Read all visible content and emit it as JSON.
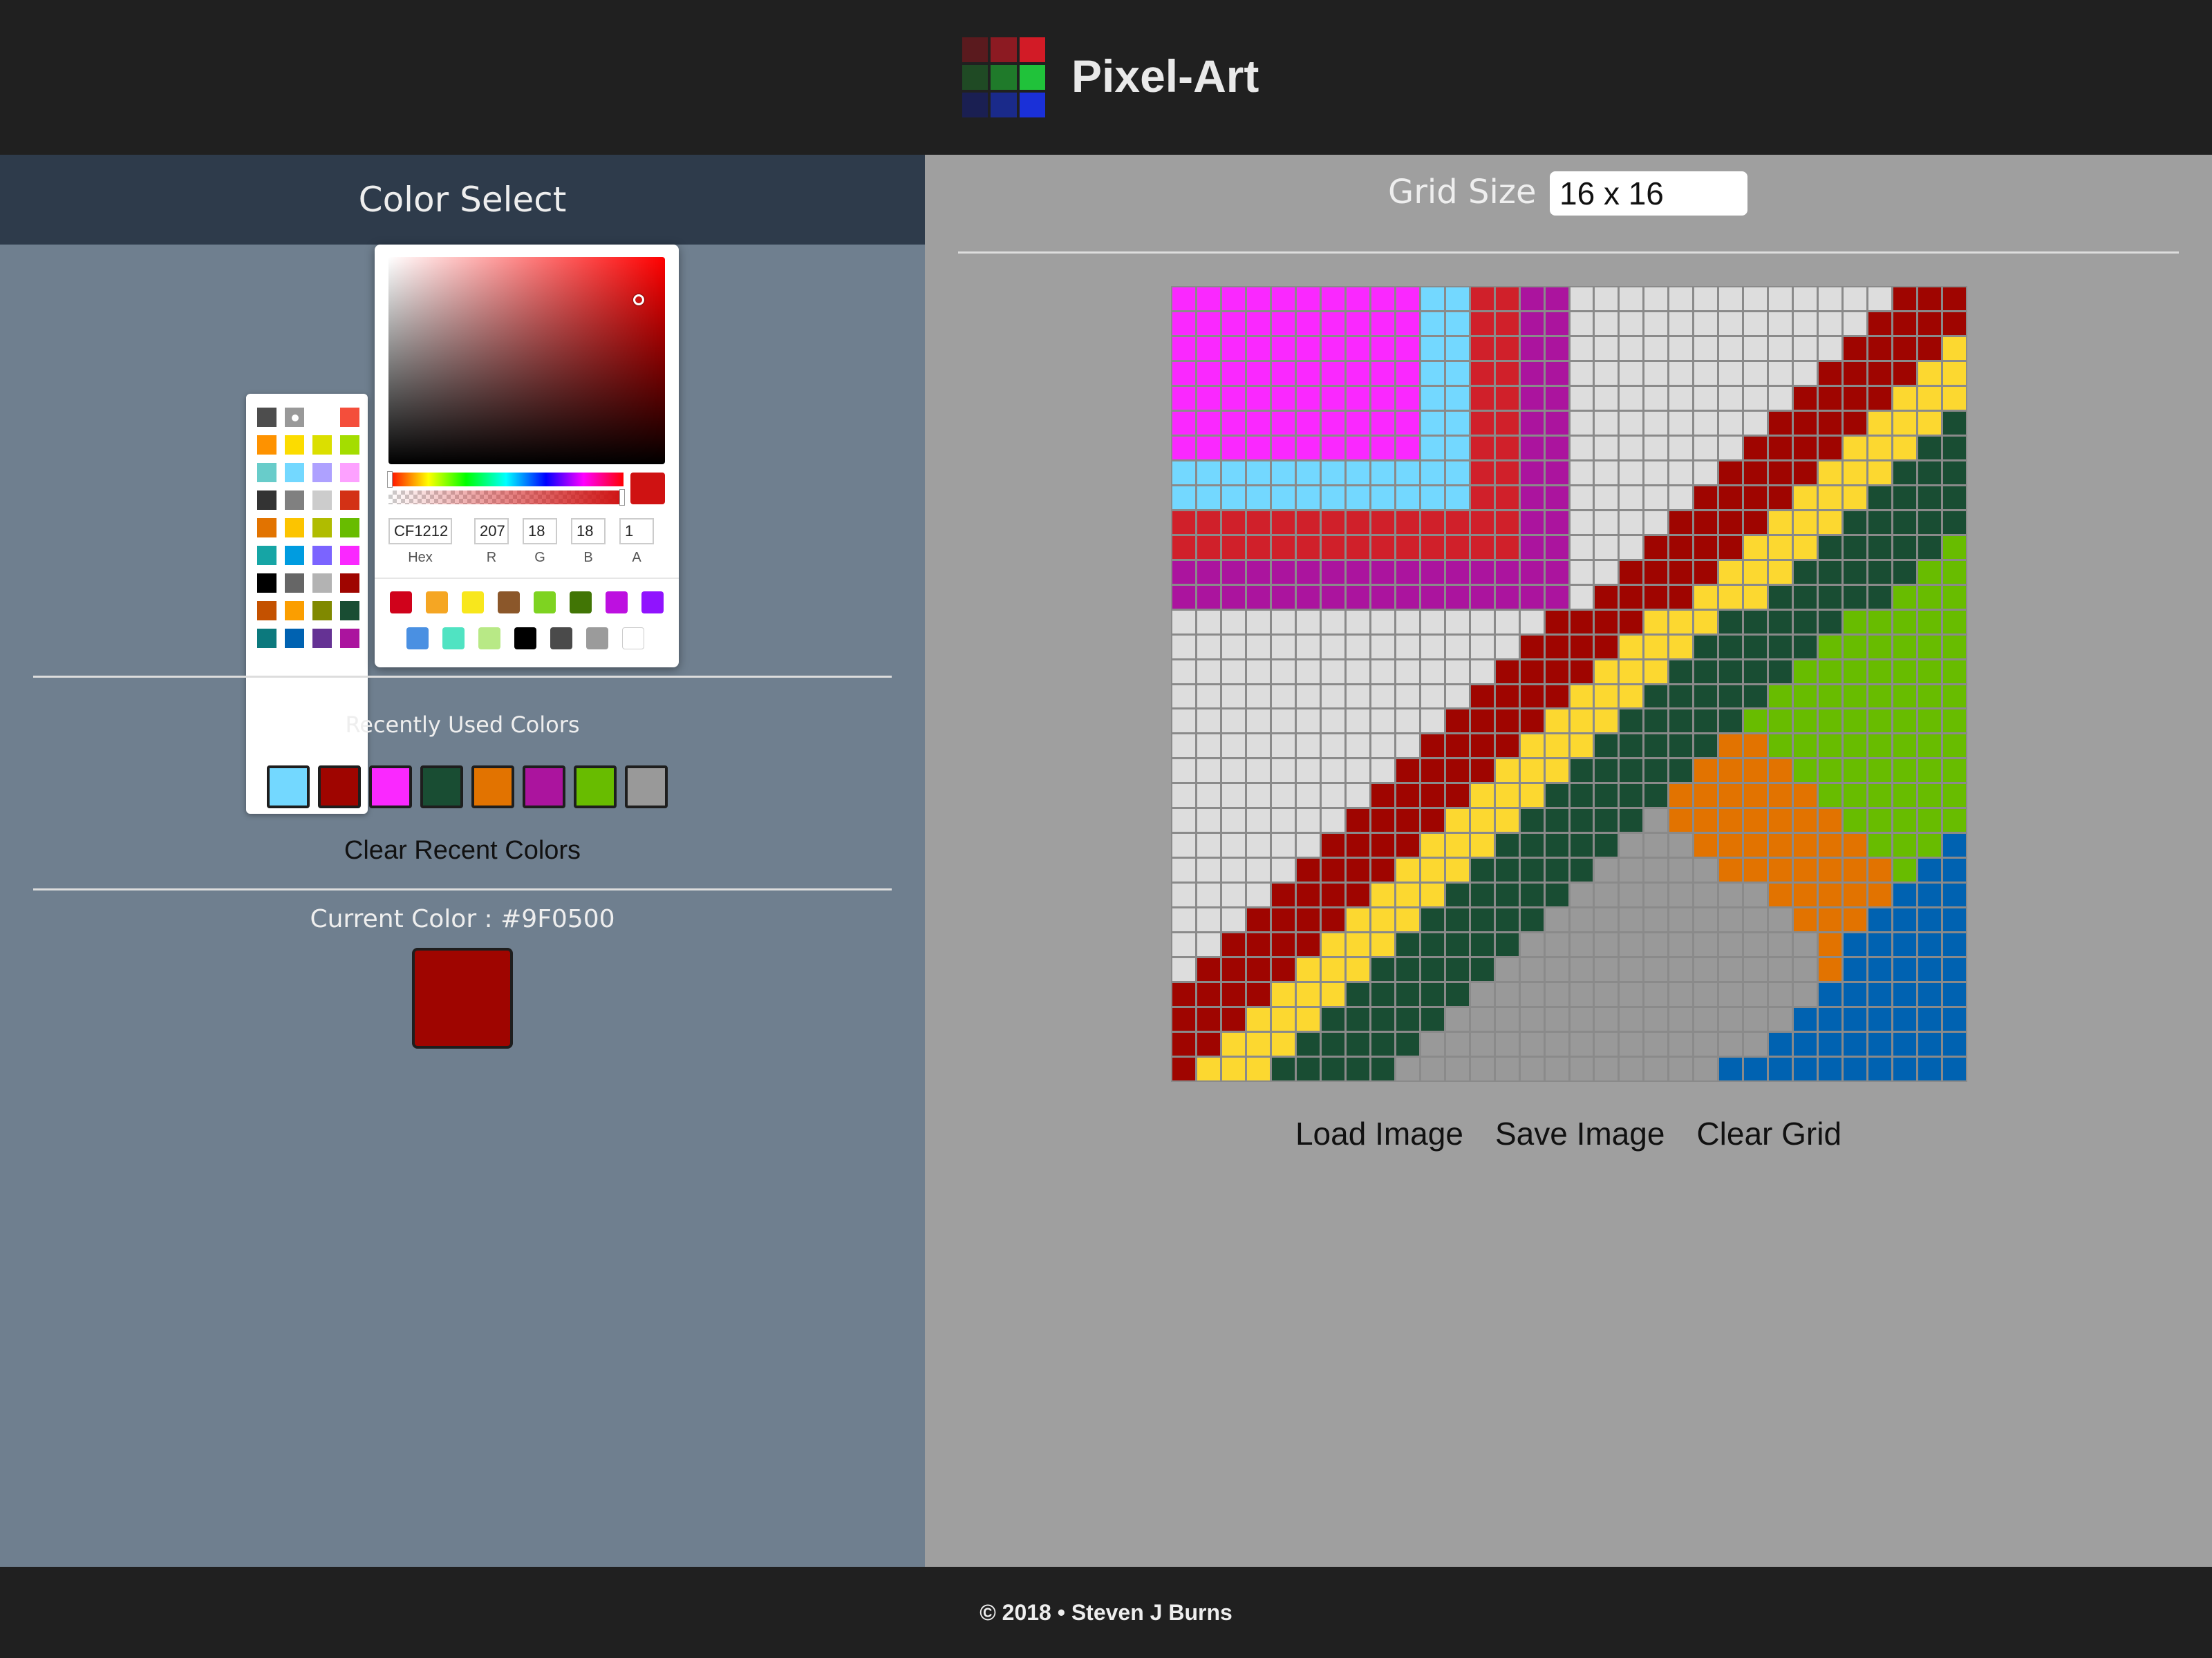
{
  "header": {
    "title": "Pixel-Art",
    "logo_colors": [
      "#5a1a1e",
      "#8c1a22",
      "#d21b26",
      "#1f4a24",
      "#1f7a2a",
      "#20c23a",
      "#1a1f52",
      "#1a2a8a",
      "#1a30d8"
    ]
  },
  "left": {
    "heading": "Color Select",
    "palette": [
      "#4d4d4d",
      "#999999",
      "#ffffff",
      "#f44e3b",
      "#fe9200",
      "#fcdc00",
      "#dbdf00",
      "#a4dd00",
      "#68ccca",
      "#73d8ff",
      "#aea1ff",
      "#fda1ff",
      "#333333",
      "#808080",
      "#cccccc",
      "#d33115",
      "#e27300",
      "#fcc400",
      "#b0bc00",
      "#68bc00",
      "#16a5a5",
      "#009ce0",
      "#7b64ff",
      "#fa28ff",
      "#000000",
      "#666666",
      "#b3b3b3",
      "#9f0500",
      "#c45100",
      "#fb9e00",
      "#808900",
      "#194d33",
      "#0c797d",
      "#0062b1",
      "#653294",
      "#ab149e"
    ],
    "palette_selected_index": 1,
    "picker": {
      "hex": "CF1212",
      "r": "207",
      "g": "18",
      "b": "18",
      "a": "1",
      "hex_label": "Hex",
      "r_label": "R",
      "g_label": "G",
      "b_label": "B",
      "a_label": "A",
      "current": "#cf1212",
      "presets": [
        "#d0021b",
        "#f5a623",
        "#f8e71c",
        "#8b572a",
        "#7ed321",
        "#417505",
        "#bd10e0",
        "#9013fe",
        "#4a90e2",
        "#50e3c2",
        "#b8e986",
        "#000000",
        "#4a4a4a",
        "#9b9b9b",
        "#ffffff"
      ]
    },
    "recent_label": "Recently Used Colors",
    "recent_colors": [
      "#73d8ff",
      "#9f0500",
      "#fa28ff",
      "#194d33",
      "#e27300",
      "#ab149e",
      "#68bc00",
      "#999999"
    ],
    "clear_recent": "Clear Recent Colors",
    "current_label": "Current Color : #9F0500",
    "current_color": "#9f0500"
  },
  "right": {
    "grid_size_label": "Grid Size :",
    "grid_size_value": "16 x 16",
    "load": "Load Image",
    "save": "Save Image",
    "clear": "Clear Grid",
    "pixels": [
      "MMMMMMMMMMCCRRPPWWWWWWWWWWWWWDDDDD",
      "MMMMMMMMMMCCRRPPWWWWWWWWWWWWDDDDYY",
      "MMMMMMMMMMCCRRPPWWWWWWWWWWWDDDDYYY",
      "MMMMMMMMMMCCRRPPWWWWWWWWWWDDDDYYYY",
      "MMMMMMMMMMCCRRPPWWWWWWWWWDDDDYYYGG",
      "MMMMMMMMMMCCRRPPWWWWWWWWDDDDYYYGGG",
      "MMMMMMMMMMCCRRPPWWWWWWWDDDDYYYGGGG",
      "CCCCCCCCCCCCRRPPWWWWWWDDDDYYYGGGGG",
      "CCCCCCCCCCCCRRPPWWWWWDDDDYYYGGGGGG",
      "RRRRRRRRRRRRRRPPWWWWDDDDYYYGGGGGLL",
      "RRRRRRRRRRRRRRPPWWWDDDDYYYGGGGGLLL",
      "PPPPPPPPPPPPPPPPWWDDDDYYYGGGGGLLLL",
      "PPPPPPPPPPPPPPPPWDDDDYYYGGGGGLLLLL",
      "WWWWWWWWWWWWWWWDDDDYYYGGGGGLLLLLLL",
      "WWWWWWWWWWWWWWDDDDYYYGGGGGLLLLLLLL",
      "WWWWWWWWWWWWWDDDDYYYGGGGGLLLLLLLLL",
      "WWWWWWWWWWWWDDDDYYYGGGGGLLLLLLLLLL",
      "WWWWWWWWWWWDDDDYYYGGGGGLLLLLLLLLLL",
      "WWWWWWWWWWDDDDYYYGGGGGOOLLLLLLLLLL",
      "WWWWWWWWWDDDDYYYGGGGGOOOOLLLLLLLLL",
      "WWWWWWWWDDDDYYYGGGGGOOOOOOLLLLLLLL",
      "WWWWWWWDDDDYYYGGGGGAOOOOOOOLLLLLLB",
      "WWWWWWDDDDYYYGGGGGAAAOOOOOOOLLLBBB",
      "WWWWWDDDDYYYGGGGGAAAAAOOOOOOOLBBBB",
      "WWWWDDDDYYYGGGGGAAAAAAAAOOOOOBBBBB",
      "WWWDDDDYYYGGGGGAAAAAAAAAAOOOBBBBBB",
      "WWDDDDYYYGGGGGAAAAAAAAAAAAOBBBBBBB",
      "WDDDDYYYGGGGGAAAAAAAAAAAAAOBBBBBBB",
      "DDDDYYYGGGGGAAAAAAAAAAAAAABBBBBBBB",
      "DDDYYYGGGGGAAAAAAAAAAAAAABBBBBBBBB",
      "DDYYYGGGGGAAAAAAAAAAAAAABBBBBBBBBB",
      "DYYYGGGGGAAAAAAAAAAAAABBBBBBBBBBBB"
    ],
    "pixel_colors": {
      "M": "#fa28ff",
      "C": "#73d8ff",
      "R": "#d0202a",
      "P": "#ab149e",
      "W": "#dddddd",
      "D": "#9f0500",
      "Y": "#fcd830",
      "G": "#194d33",
      "L": "#68bc00",
      "O": "#e27300",
      "A": "#999999",
      "B": "#0062b1"
    }
  },
  "footer": {
    "text": "© 2018 • Steven J Burns"
  }
}
